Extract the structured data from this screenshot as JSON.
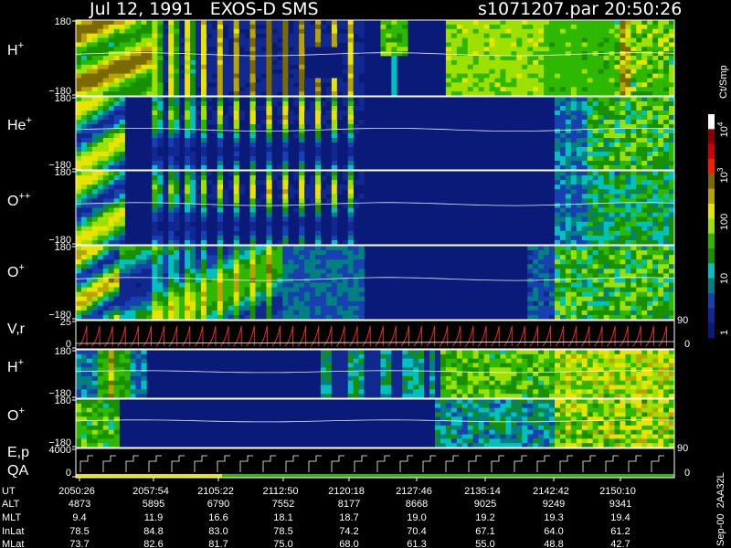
{
  "header": {
    "title": "Jul 12, 1991   EXOS-D SMS",
    "file": "s1071207.par",
    "time": "20:50:26"
  },
  "colorbar": {
    "unit": "Ct/Smp",
    "labels": [
      {
        "text": "10",
        "sup": "4"
      },
      {
        "text": "10",
        "sup": "3"
      },
      {
        "text": "100",
        "sup": ""
      },
      {
        "text": "10",
        "sup": ""
      },
      {
        "text": "1",
        "sup": ""
      }
    ],
    "colors": [
      "#ffffff",
      "#8b0000",
      "#d00000",
      "#ff1a00",
      "#7a6a00",
      "#b8a400",
      "#e8e400",
      "#9ee000",
      "#2fb800",
      "#189000",
      "#00c0c0",
      "#008080",
      "#1840b0",
      "#102890",
      "#0a1a78"
    ]
  },
  "panels": [
    {
      "label": "H",
      "sup": "+",
      "ticks": [
        "180",
        "−180"
      ],
      "kind": "H1"
    },
    {
      "label": "He",
      "sup": "+",
      "ticks": [
        "180",
        "−180"
      ],
      "kind": "He"
    },
    {
      "label": "O",
      "sup": "++",
      "ticks": [
        "180",
        "−180"
      ],
      "kind": "O2"
    },
    {
      "label": "O",
      "sup": "+",
      "ticks": [
        "180",
        "−180"
      ],
      "kind": "O1"
    },
    {
      "label": "V,r",
      "sup": "",
      "ticks": [
        "25",
        "0"
      ],
      "right_ticks": [
        "90",
        "0"
      ],
      "kind": "vr"
    },
    {
      "label": "H",
      "sup": "+",
      "ticks": [
        "180",
        "−180"
      ],
      "kind": "H2"
    },
    {
      "label": "O",
      "sup": "+",
      "ticks": [
        "180",
        "−180"
      ],
      "kind": "O3"
    },
    {
      "label": "E,p",
      "label2": "QA",
      "sup": "",
      "ticks": [
        "4000",
        "0"
      ],
      "right_ticks": [
        "90",
        "0"
      ],
      "kind": "ep"
    }
  ],
  "footer_id": "Sep-00  2AA32L",
  "orbit_table": {
    "rows": [
      {
        "name": "UT",
        "values": [
          "2050:26",
          "2057:54",
          "2105:22",
          "2112:50",
          "2120:18",
          "2127:46",
          "2135:14",
          "2142:42",
          "2150:10"
        ]
      },
      {
        "name": "ALT",
        "values": [
          "4873",
          "5895",
          "6790",
          "7552",
          "8177",
          "8668",
          "9025",
          "9249",
          "9341"
        ]
      },
      {
        "name": "MLT",
        "values": [
          "9.4",
          "11.9",
          "16.6",
          "18.1",
          "18.7",
          "19.0",
          "19.2",
          "19.3",
          "19.4"
        ]
      },
      {
        "name": "InLat",
        "values": [
          "78.5",
          "84.8",
          "83.0",
          "78.5",
          "74.2",
          "70.4",
          "67.1",
          "64.0",
          "61.2"
        ]
      },
      {
        "name": "MLat",
        "values": [
          "73.7",
          "82.6",
          "81.7",
          "75.0",
          "68.0",
          "61.3",
          "55.0",
          "48.8",
          "42.7"
        ]
      }
    ]
  },
  "chart_data": {
    "type": "heatmap",
    "title": "Jul 12, 1991   EXOS-D SMS",
    "x_labels": [
      "2050:26",
      "2057:54",
      "2105:22",
      "2112:50",
      "2120:18",
      "2127:46",
      "2135:14",
      "2142:42",
      "2150:10"
    ],
    "xrange": [
      "2050:26",
      "2150:10"
    ],
    "pitch_angle_range": [
      -180,
      180
    ],
    "color_scale": {
      "unit": "Ct/Smp",
      "log": true,
      "range": [
        1,
        10000
      ]
    },
    "series": [
      {
        "name": "H+",
        "yrange": [
          -180,
          180
        ]
      },
      {
        "name": "He+",
        "yrange": [
          -180,
          180
        ]
      },
      {
        "name": "O++",
        "yrange": [
          -180,
          180
        ]
      },
      {
        "name": "O+",
        "yrange": [
          -180,
          180
        ]
      },
      {
        "name": "V,r",
        "yrange": [
          0,
          25
        ],
        "right_range": [
          0,
          90
        ]
      },
      {
        "name": "H+",
        "yrange": [
          -180,
          180
        ]
      },
      {
        "name": "O+",
        "yrange": [
          -180,
          180
        ]
      },
      {
        "name": "E,p / QA",
        "yrange": [
          0,
          4000
        ],
        "right_range": [
          0,
          90
        ]
      }
    ]
  }
}
